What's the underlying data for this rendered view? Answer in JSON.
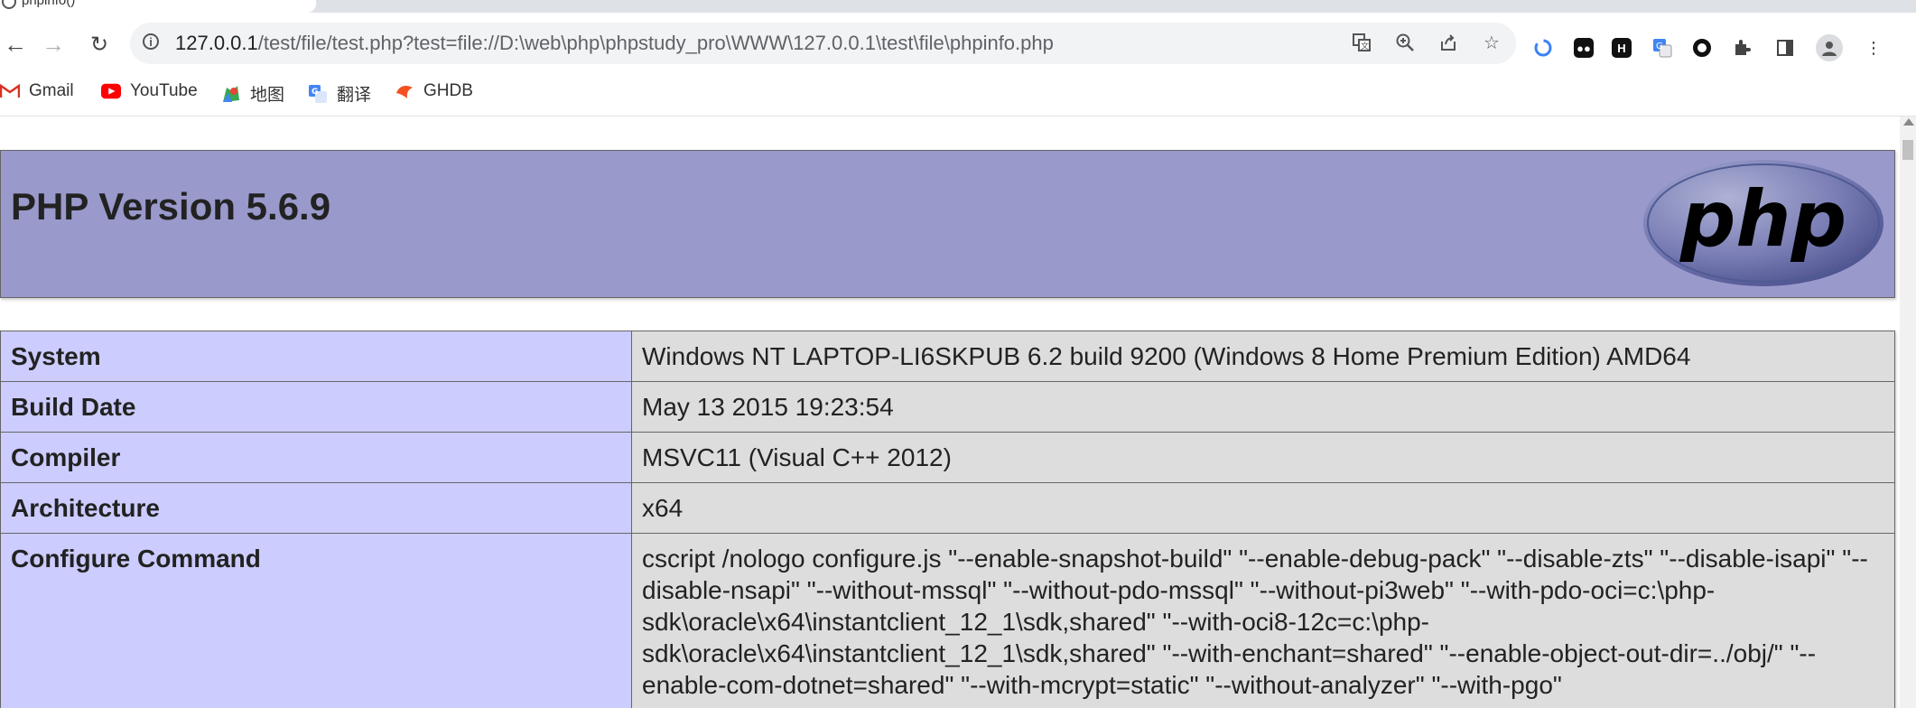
{
  "browser": {
    "tab_title": "phpinfo()",
    "url_host": "127.0.0.1",
    "url_path": "/test/file/test.php?test=file://D:\\web\\php\\phpstudy_pro\\WWW\\127.0.0.1\\test\\file\\phpinfo.php",
    "bookmarks": [
      {
        "label": "Gmail",
        "icon": "gmail-icon"
      },
      {
        "label": "YouTube",
        "icon": "youtube-icon"
      },
      {
        "label": "地图",
        "icon": "maps-icon"
      },
      {
        "label": "翻译",
        "icon": "translate-icon"
      },
      {
        "label": "GHDB",
        "icon": "ghdb-icon"
      }
    ]
  },
  "page": {
    "title": "PHP Version 5.6.9",
    "logo_text": "php",
    "rows": [
      {
        "key": "System",
        "value": "Windows NT LAPTOP-LI6SKPUB 6.2 build 9200 (Windows 8 Home Premium Edition) AMD64"
      },
      {
        "key": "Build Date",
        "value": "May 13 2015 19:23:54"
      },
      {
        "key": "Compiler",
        "value": "MSVC11 (Visual C++ 2012)"
      },
      {
        "key": "Architecture",
        "value": "x64"
      },
      {
        "key": "Configure Command",
        "value": "cscript /nologo configure.js \"--enable-snapshot-build\" \"--enable-debug-pack\" \"--disable-zts\" \"--disable-isapi\" \"--disable-nsapi\" \"--without-mssql\" \"--without-pdo-mssql\" \"--without-pi3web\" \"--with-pdo-oci=c:\\php-sdk\\oracle\\x64\\instantclient_12_1\\sdk,shared\" \"--with-oci8-12c=c:\\php-sdk\\oracle\\x64\\instantclient_12_1\\sdk,shared\" \"--with-enchant=shared\" \"--enable-object-out-dir=../obj/\" \"--enable-com-dotnet=shared\" \"--with-mcrypt=static\" \"--without-analyzer\" \"--with-pgo\""
      }
    ]
  },
  "colors": {
    "header_bg": "#9999cc",
    "key_bg": "#ccccff",
    "value_bg": "#dddddd"
  }
}
